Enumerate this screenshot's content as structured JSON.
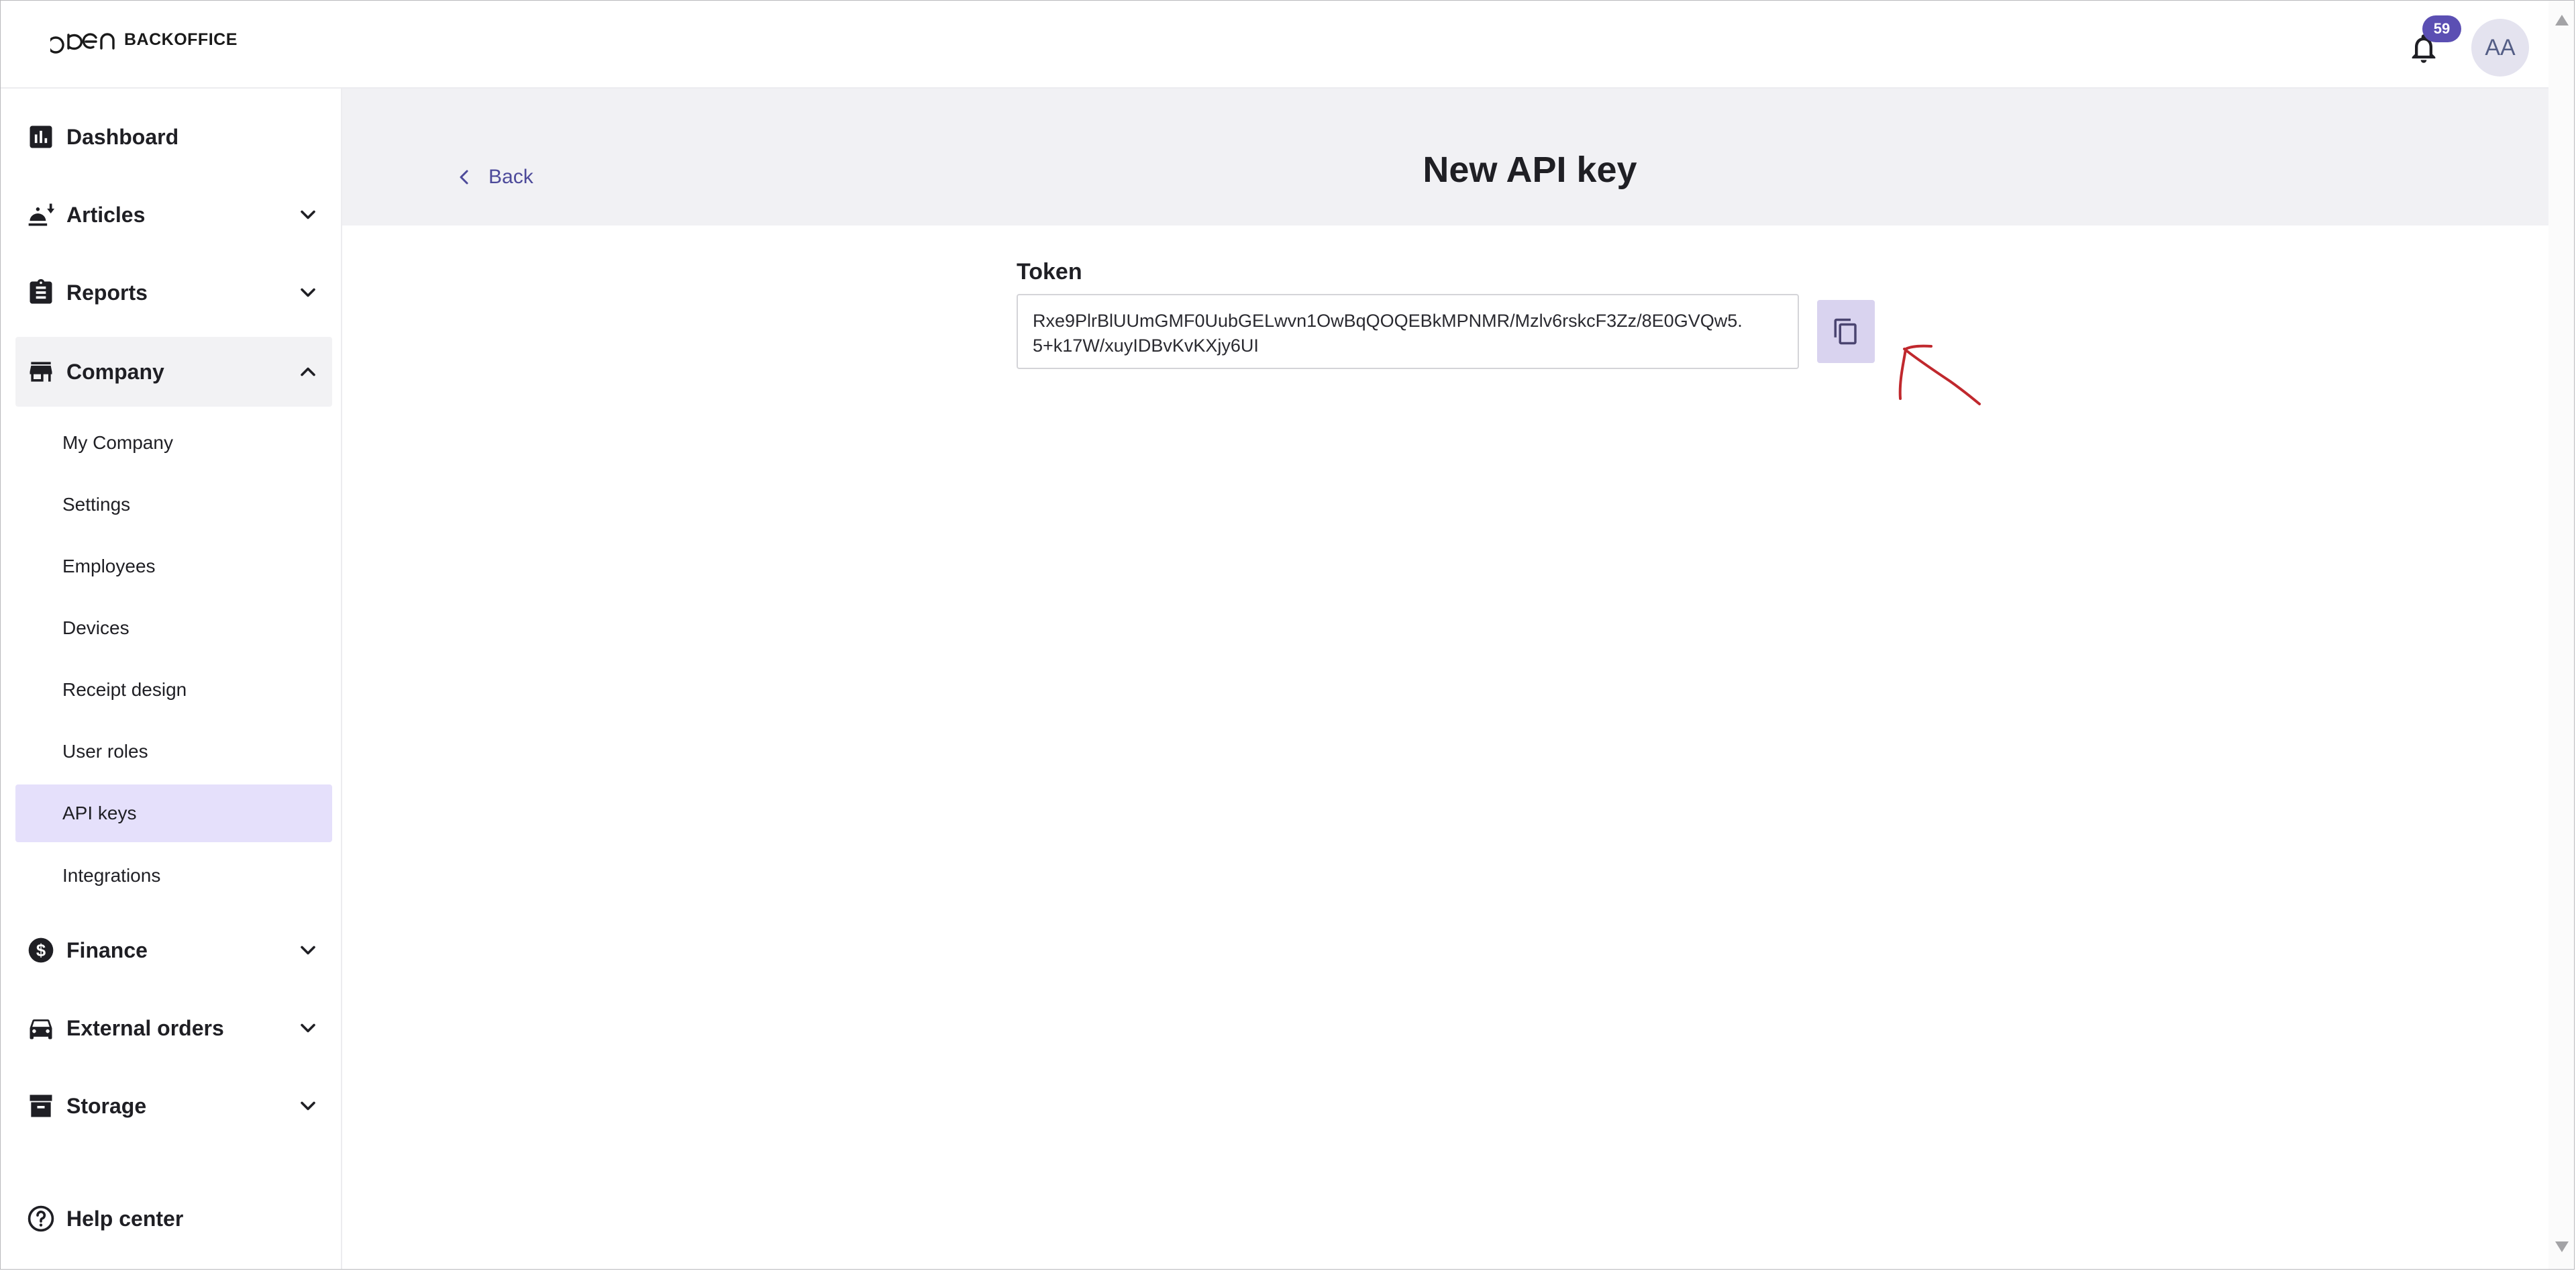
{
  "header": {
    "logo_text": "BACKOFFICE",
    "notifications_count": "59",
    "avatar_initials": "AA"
  },
  "sidebar": {
    "items": [
      {
        "label": "Dashboard",
        "icon": "bar-chart-icon"
      },
      {
        "label": "Articles",
        "icon": "articles-icon"
      },
      {
        "label": "Reports",
        "icon": "clipboard-icon"
      },
      {
        "label": "Company",
        "icon": "store-icon"
      },
      {
        "label": "Finance",
        "icon": "dollar-icon"
      },
      {
        "label": "External orders",
        "icon": "car-icon"
      },
      {
        "label": "Storage",
        "icon": "archive-icon"
      }
    ],
    "company_subitems": [
      "My Company",
      "Settings",
      "Employees",
      "Devices",
      "Receipt design",
      "User roles",
      "API keys",
      "Integrations"
    ],
    "active_subitem": "API keys",
    "help_label": "Help center"
  },
  "page": {
    "back_label": "Back",
    "title": "New API key",
    "token_label": "Token",
    "token_value": "Rxe9PlrBlUUmGMF0UubGELwvn1OwBqQOQEBkMPNMR/Mzlv6rskcF3Zz/8E0GVQw5.\n5+k17W/xuyIDBvKvKXjy6UI"
  },
  "colors": {
    "accent": "#5b4fb3",
    "active_bg": "#e5e0fb",
    "header_bg": "#f1f1f4",
    "copy_button_bg": "#d9d3ef",
    "annotation": "#c0282d"
  }
}
